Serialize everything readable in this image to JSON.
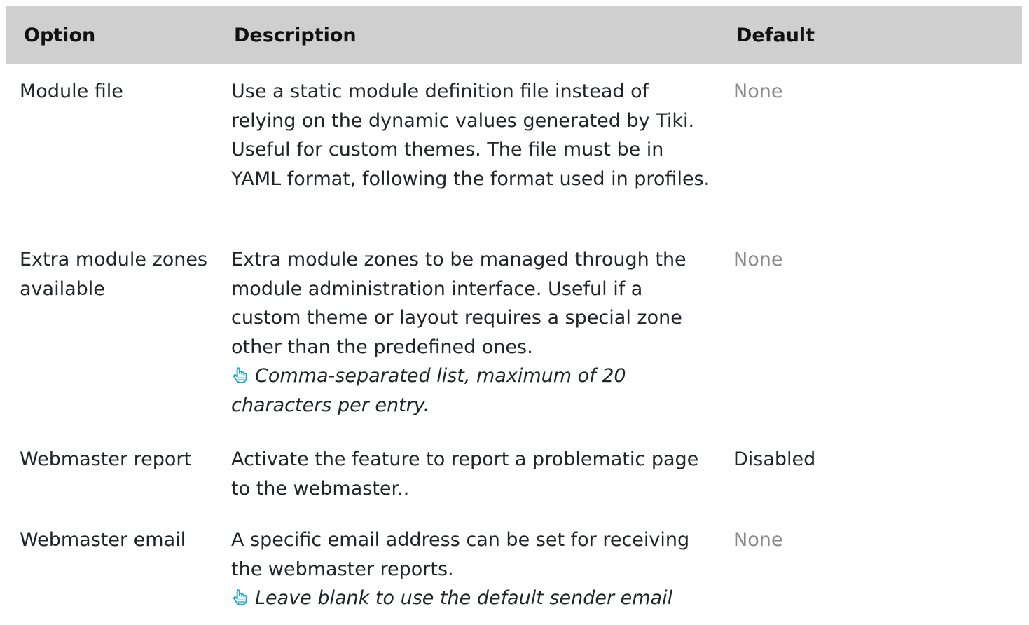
{
  "columns": {
    "option": "Option",
    "description": "Description",
    "default": "Default"
  },
  "rows": [
    {
      "option": "Module file",
      "description": "Use a static module definition file instead of relying on the dynamic values generated by Tiki. Useful for custom themes. The file must be in YAML format, following the format used in profiles.",
      "note": "",
      "default": "None"
    },
    {
      "option": "Extra module zones available",
      "description": "Extra module zones to be managed through the module administration interface. Useful if a custom theme or layout requires a special zone other than the predefined ones.",
      "note": "Comma-separated list, maximum of 20 characters per entry.",
      "default": "None"
    },
    {
      "option": "Webmaster report",
      "description": "Activate the feature to report a problematic page to the webmaster..",
      "note": "",
      "default": "Disabled"
    },
    {
      "option": "Webmaster email",
      "description": "A specific email address can be set for receiving the webmaster reports.",
      "note": "Leave blank to use the default sender email",
      "default": "None"
    }
  ],
  "icons": {
    "tip": "pointing-hand-icon"
  },
  "colors": {
    "header_bg": "#cfcfcf",
    "muted_text": "#8a8a8a",
    "icon": "#1aa6d6"
  }
}
